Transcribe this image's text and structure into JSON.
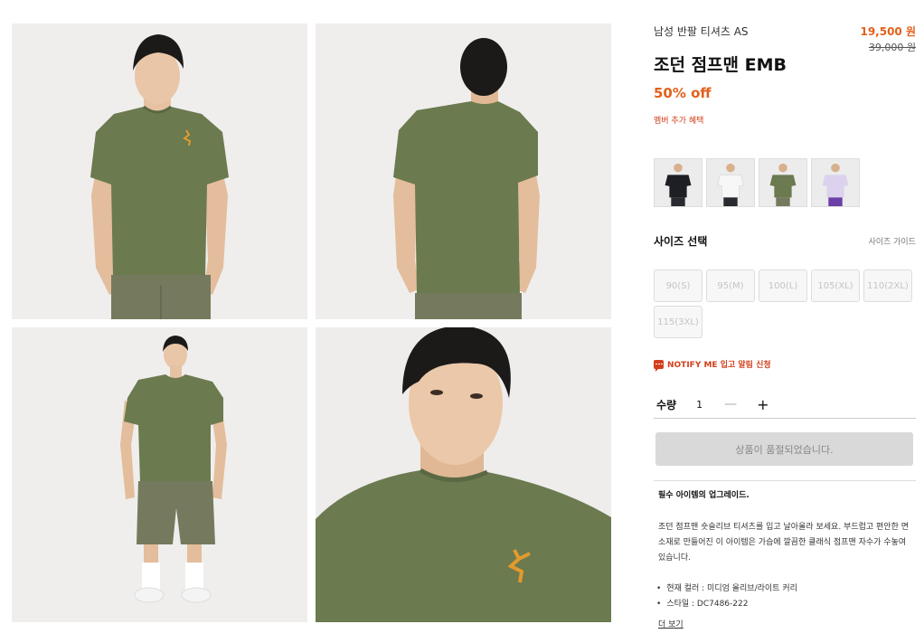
{
  "colors": {
    "accent": "#e2611b",
    "alert": "#d2401b",
    "shirt": "#6b7a4f",
    "disabled_button": "#d9d9d9"
  },
  "gallery": {
    "images": [
      {
        "name": "front-view"
      },
      {
        "name": "back-view"
      },
      {
        "name": "full-body-view"
      },
      {
        "name": "closeup-view"
      }
    ]
  },
  "product": {
    "category": "남성 반팔 티셔츠 AS",
    "price": "19,500 원",
    "original_price": "39,000 원",
    "title": "조던 점프맨 EMB",
    "discount": "50% off",
    "member_benefit": "멤버 추가 혜택"
  },
  "color_options": [
    {
      "name": "black",
      "color": "#1e1f24"
    },
    {
      "name": "white",
      "color": "#f4f4f4"
    },
    {
      "name": "olive",
      "color": "#6b7a4f"
    },
    {
      "name": "lavender",
      "color": "#dcd2ee"
    }
  ],
  "size": {
    "label": "사이즈 선택",
    "guide": "사이즈 가이드",
    "options": [
      "90(S)",
      "95(M)",
      "100(L)",
      "105(XL)",
      "110(2XL)",
      "115(3XL)"
    ]
  },
  "notify": {
    "label": "NOTIFY ME 입고 알림 신청",
    "icon": "chat-bubble-icon"
  },
  "quantity": {
    "label": "수량",
    "value": "1",
    "minus": "—",
    "plus": "+"
  },
  "cta": {
    "label": "상품이 품절되었습니다."
  },
  "description": {
    "heading": "필수 아이템의 업그레이드.",
    "body": "조던 점프맨 숏슬리브 티셔츠를 입고 날아올라 보세요. 부드럽고 편안한 면 소재로 만들어진 이 아이템은 가슴에 깔끔한 클래식 점프맨 자수가 수놓여 있습니다.",
    "bullets": [
      "현재 컬러 : 미디엄 올리브/라이트 커리",
      "스타일 : DC7486-222"
    ],
    "more": "더 보기"
  }
}
